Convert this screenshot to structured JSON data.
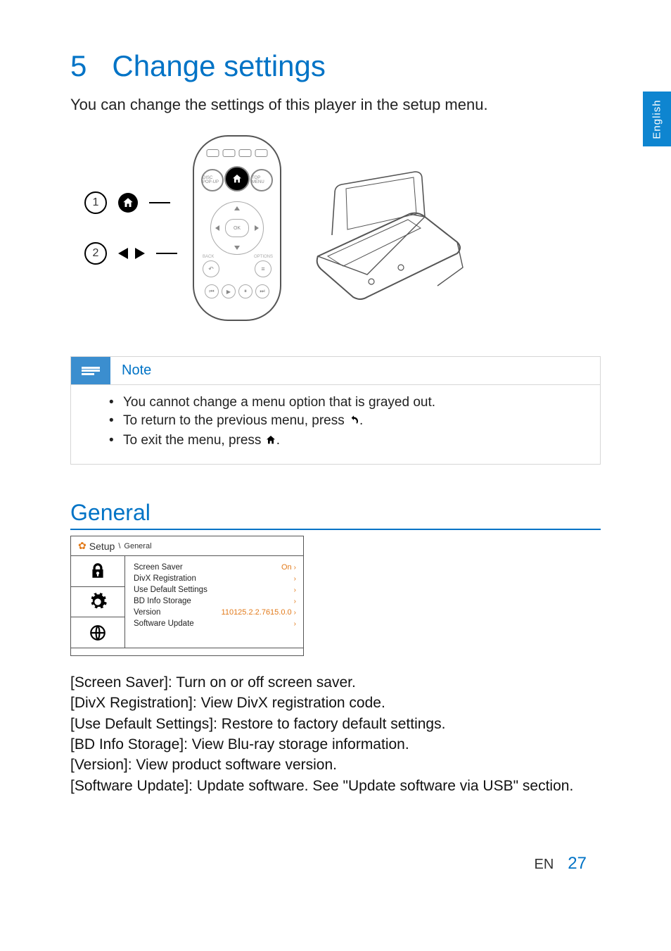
{
  "language_tab": "English",
  "chapter_number": "5",
  "chapter_title": "Change settings",
  "intro": "You can change the settings of this player in the setup menu.",
  "callouts": {
    "step1": "1",
    "step2": "2"
  },
  "remote": {
    "ok": "OK",
    "disc_popup": "DISC POP-UP",
    "top_menu": "TOP MENU",
    "back_label": "BACK",
    "options_label": "OPTIONS"
  },
  "note": {
    "title": "Note",
    "items": [
      "You cannot change a menu option that is grayed out.",
      "To return to the previous menu, press ",
      "To exit the menu, press "
    ],
    "item2_suffix": ".",
    "item3_suffix": "."
  },
  "general": {
    "heading": "General",
    "menu": {
      "breadcrumb_root": "Setup",
      "breadcrumb_sep": "\\",
      "breadcrumb_leaf": "General",
      "rows": [
        {
          "label": "Screen Saver",
          "value": "On"
        },
        {
          "label": "DivX Registration",
          "value": ""
        },
        {
          "label": "Use Default Settings",
          "value": ""
        },
        {
          "label": "BD Info Storage",
          "value": ""
        },
        {
          "label": "Version",
          "value": "110125.2.2.7615.0.0"
        },
        {
          "label": "Software Update",
          "value": ""
        }
      ]
    },
    "definitions": [
      {
        "key": "[Screen Saver]",
        "text": ": Turn on or off screen saver."
      },
      {
        "key": "[DivX Registration]",
        "text": ": View DivX registration code."
      },
      {
        "key": "[Use Default Settings]",
        "text": ": Restore to factory default settings."
      },
      {
        "key": "[BD Info Storage]",
        "text": ": View Blu-ray storage information."
      },
      {
        "key": "[Version]",
        "text": ": View product software version."
      },
      {
        "key": "[Software Update]",
        "text": ": Update software. See \"Update software via USB\" section."
      }
    ]
  },
  "footer": {
    "lang": "EN",
    "page": "27"
  }
}
